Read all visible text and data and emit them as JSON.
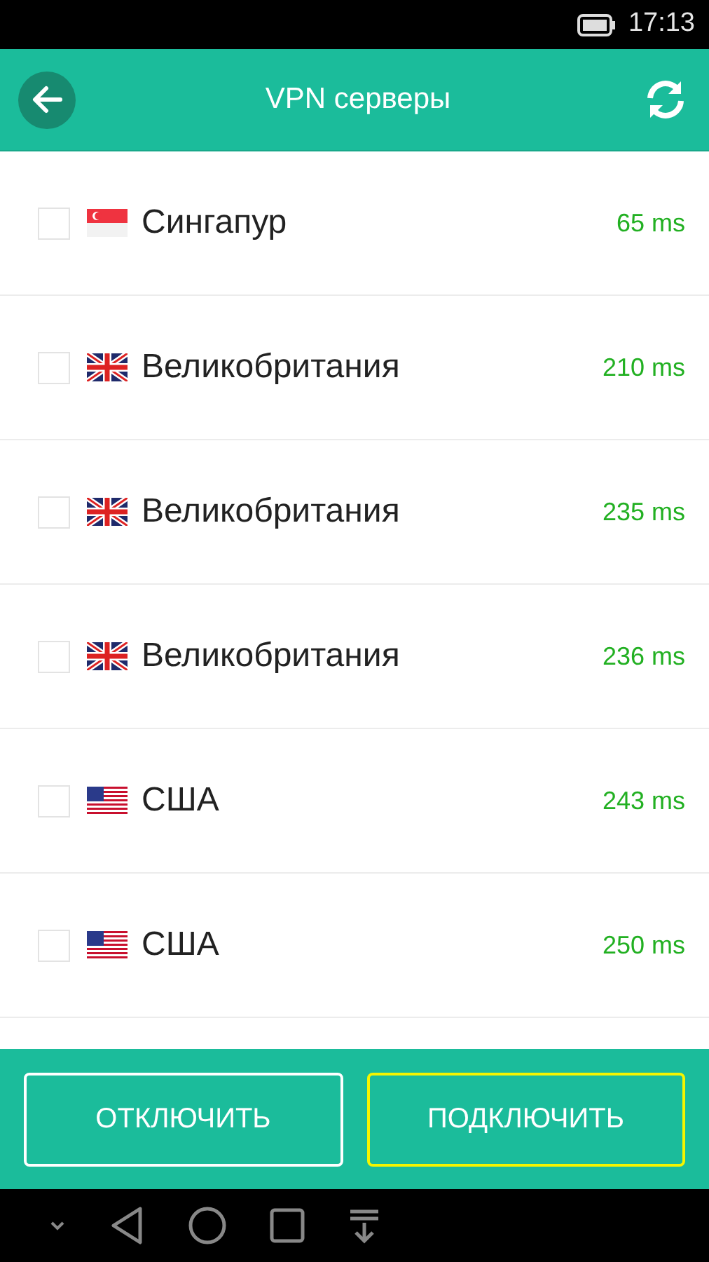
{
  "status_bar": {
    "time": "17:13"
  },
  "header": {
    "title": "VPN серверы"
  },
  "servers": [
    {
      "kind": "sg",
      "country": "Сингапур",
      "ping": "65 ms",
      "checked": false
    },
    {
      "kind": "gb",
      "country": "Великобритания",
      "ping": "210 ms",
      "checked": false
    },
    {
      "kind": "gb",
      "country": "Великобритания",
      "ping": "235 ms",
      "checked": false
    },
    {
      "kind": "gb",
      "country": "Великобритания",
      "ping": "236 ms",
      "checked": false
    },
    {
      "kind": "us",
      "country": "США",
      "ping": "243 ms",
      "checked": false
    },
    {
      "kind": "us",
      "country": "США",
      "ping": "250 ms",
      "checked": false
    }
  ],
  "buttons": [
    {
      "label": "ОТКЛЮЧИТЬ",
      "selected": false
    },
    {
      "label": "ПОДКЛЮЧИТЬ",
      "selected": true
    }
  ]
}
